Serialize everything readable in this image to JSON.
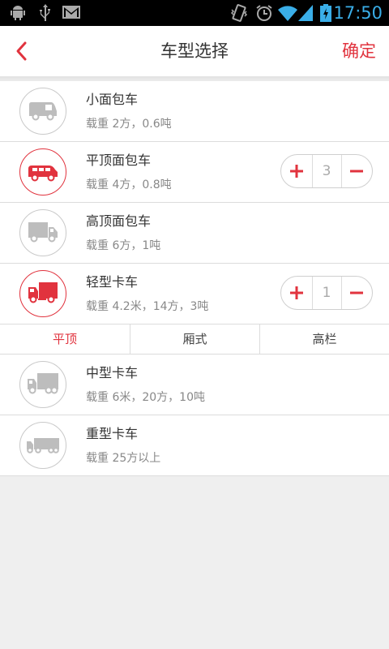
{
  "status_bar": {
    "time": "17:50",
    "icons": [
      "android-icon",
      "usb-icon",
      "gmail-icon",
      "vibrate-icon",
      "alarm-icon",
      "wifi-icon",
      "signal-icon",
      "battery-icon"
    ]
  },
  "header": {
    "title": "车型选择",
    "confirm_label": "确定",
    "back_icon": "chevron-left-icon"
  },
  "colors": {
    "accent": "#e1333e",
    "text": "#333333",
    "muted": "#888888",
    "background": "#efefef"
  },
  "vehicles": [
    {
      "name": "小面包车",
      "desc": "载重 2方，0.6吨",
      "icon": "mini-van-icon",
      "selected": false
    },
    {
      "name": "平顶面包车",
      "desc": "载重 4方，0.8吨",
      "icon": "flat-roof-van-icon",
      "selected": true,
      "quantity": "3"
    },
    {
      "name": "高顶面包车",
      "desc": "载重 6方，1吨",
      "icon": "high-roof-van-icon",
      "selected": false
    },
    {
      "name": "轻型卡车",
      "desc": "载重 4.2米，14方，3吨",
      "icon": "light-truck-icon",
      "selected": true,
      "quantity": "1"
    },
    {
      "name": "中型卡车",
      "desc": "载重 6米，20方，10吨",
      "icon": "medium-truck-icon",
      "selected": false
    },
    {
      "name": "重型卡车",
      "desc": "载重 25方以上",
      "icon": "heavy-truck-icon",
      "selected": false
    }
  ],
  "subtabs": {
    "items": [
      "平顶",
      "厢式",
      "高栏"
    ],
    "active": "平顶"
  }
}
